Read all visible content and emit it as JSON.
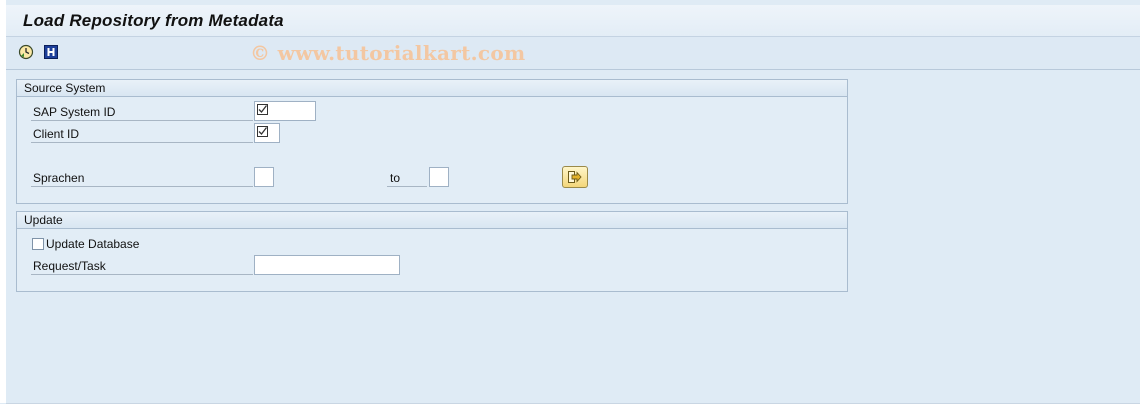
{
  "window": {
    "title": "Load Repository from Metadata"
  },
  "toolbar": {
    "icons": [
      "execute-icon",
      "info-icon"
    ],
    "watermark": "© www.tutorialkart.com"
  },
  "source_system": {
    "title": "Source System",
    "sap_system_id_label": "SAP System ID",
    "sap_system_id_value": "",
    "client_id_label": "Client ID",
    "client_id_value": "",
    "languages_label": "Sprachen",
    "languages_from": "",
    "to_label": "to",
    "languages_to": ""
  },
  "update": {
    "title": "Update",
    "update_database_label": "Update Database",
    "update_database_checked": false,
    "request_task_label": "Request/Task",
    "request_task_value": ""
  }
}
